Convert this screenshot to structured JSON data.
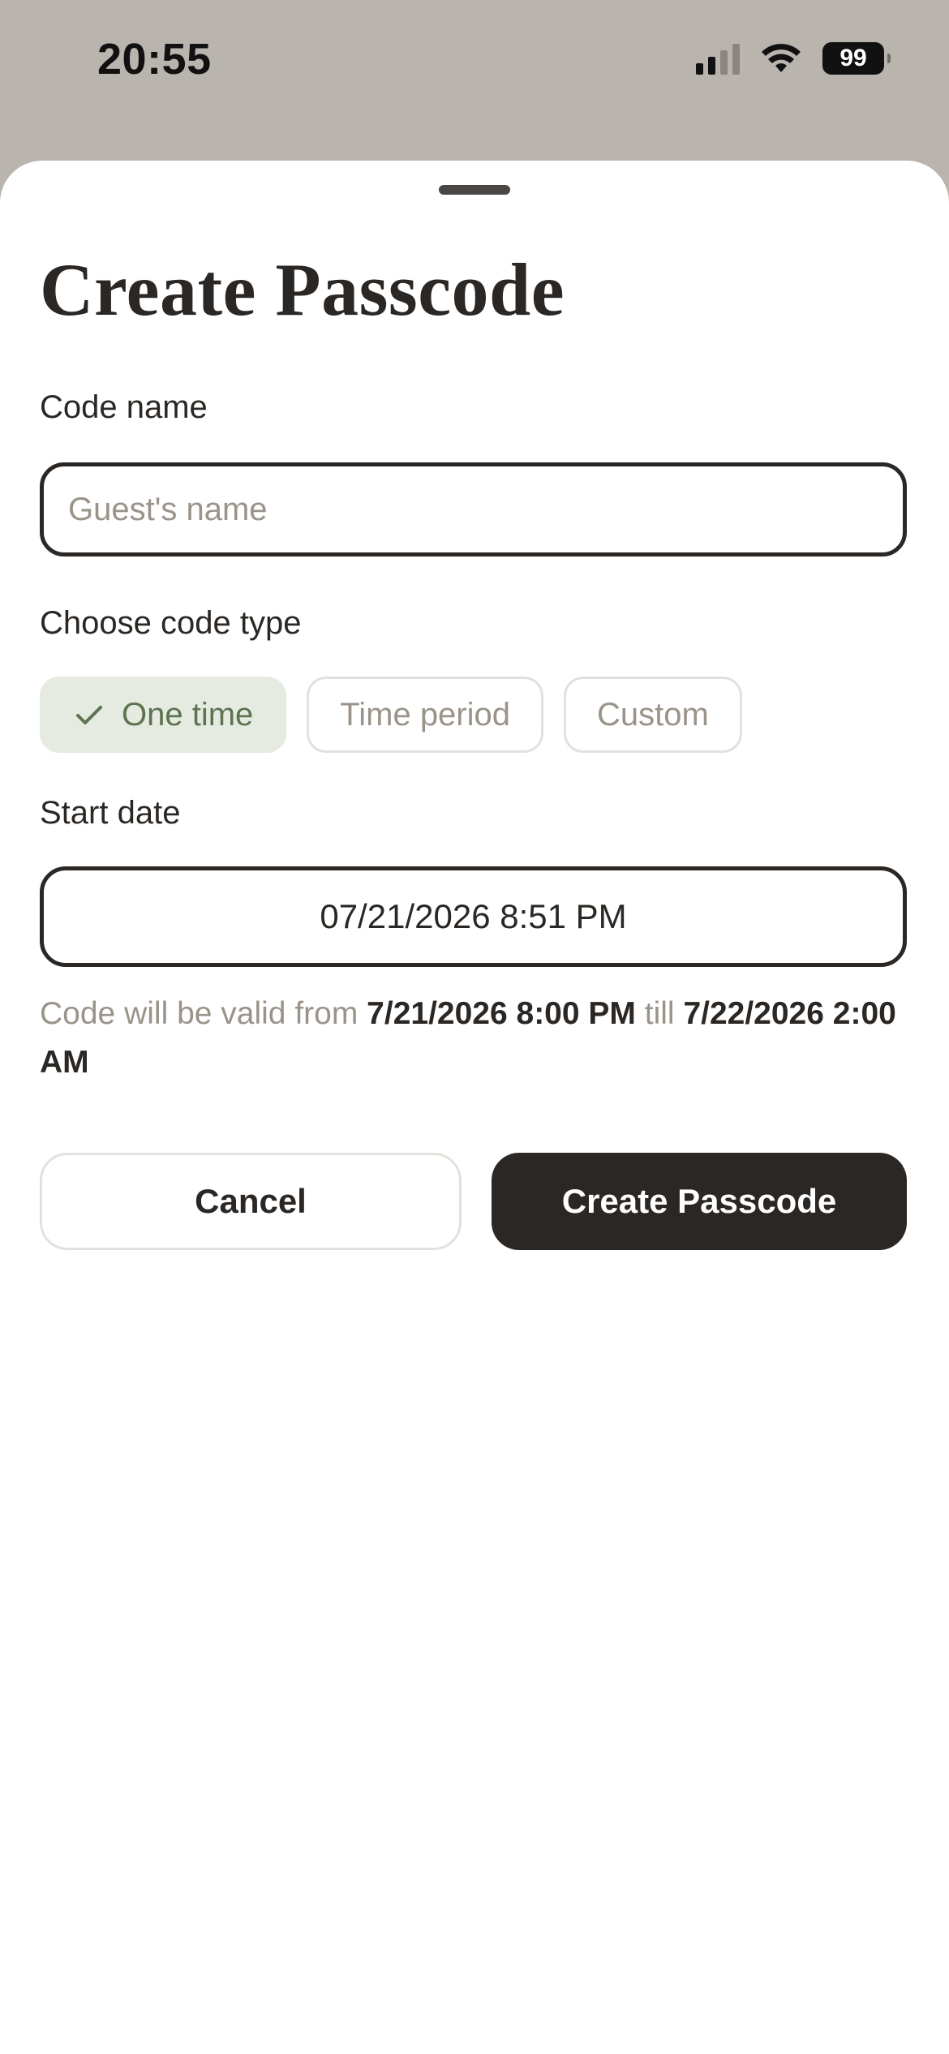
{
  "status_bar": {
    "time": "20:55",
    "battery": "99",
    "icons": [
      "cellular-signal-icon",
      "wifi-icon",
      "battery-icon"
    ]
  },
  "sheet": {
    "title": "Create Passcode",
    "code_name": {
      "label": "Code name",
      "value": "",
      "placeholder": "Guest's name"
    },
    "code_type": {
      "label": "Choose code type",
      "options": [
        {
          "label": "One time",
          "selected": true,
          "icon": "checkmark-icon"
        },
        {
          "label": "Time period",
          "selected": false
        },
        {
          "label": "Custom",
          "selected": false
        }
      ]
    },
    "start_date": {
      "label": "Start date",
      "value": "07/21/2026 8:51 PM"
    },
    "validity": {
      "prefix": "Code will be valid from",
      "from": "7/21/2026 8:00 PM",
      "middle": "till",
      "till": "7/22/2026 2:00 AM"
    },
    "actions": {
      "cancel_label": "Cancel",
      "create_label": "Create Passcode"
    }
  },
  "colors": {
    "primary": "#2b2724",
    "selected_chip_bg": "#e6ebe2",
    "selected_chip_text": "#5e7351",
    "muted_text": "#9a9389",
    "status_bar_bg": "#b9b4ae"
  }
}
